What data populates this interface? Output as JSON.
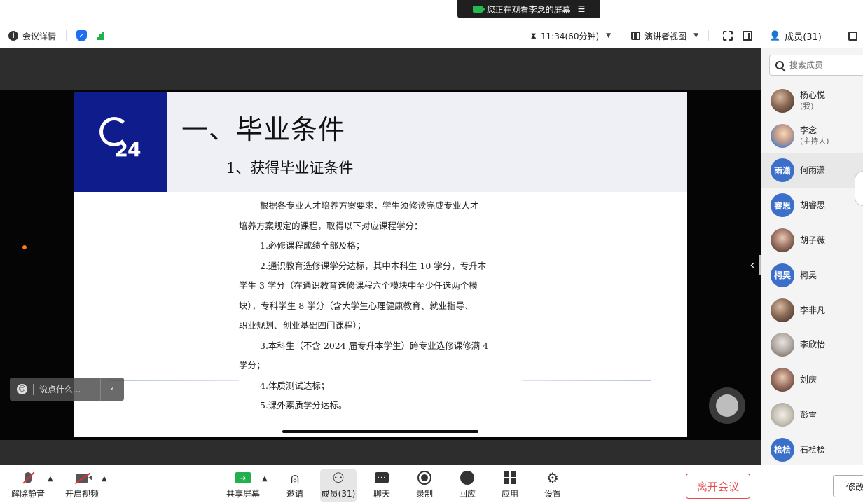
{
  "banner": {
    "text": "您正在观看李念的屏幕",
    "menu_icon": "three-lines-menu"
  },
  "meeting_bar": {
    "info_label": "会议详情",
    "timer": "11:34(60分钟)",
    "view_label": "演讲者视图"
  },
  "members_header": {
    "title": "成员(31)"
  },
  "slide": {
    "title": "一、毕业条件",
    "subtitle": "1、获得毕业证条件",
    "logo_text": "24",
    "lines": [
      "根据各专业人才培养方案要求，学生须修读完成专业人才",
      "培养方案规定的课程，取得以下对应课程学分：",
      "1.必修课程成绩全部及格；",
      "2.通识教育选修课学分达标，其中本科生 10 学分，专升本",
      "学生 3 学分（在通识教育选修课程六个模块中至少任选两个模",
      "块），专科学生 8 学分（含大学生心理健康教育、就业指导、",
      "职业规划、创业基础四门课程）；",
      "3.本科生（不含 2024 届专升本学生）跨专业选修课修满 4",
      "学分；",
      "4.体质测试达标；",
      "5.课外素质学分达标。"
    ]
  },
  "chat": {
    "placeholder": "说点什么..."
  },
  "search": {
    "placeholder": "搜索成员"
  },
  "members": [
    {
      "name": "杨心悦",
      "role": "(我)",
      "avatar": "photo"
    },
    {
      "name": "李念",
      "role": "(主持人)",
      "avatar": "photo"
    },
    {
      "name": "何雨潇",
      "role": "",
      "avatar_text": "雨潇"
    },
    {
      "name": "胡睿思",
      "role": "",
      "avatar_text": "睿思"
    },
    {
      "name": "胡子薇",
      "role": "",
      "avatar": "photo"
    },
    {
      "name": "柯昊",
      "role": "",
      "avatar_text": "柯昊"
    },
    {
      "name": "李非凡",
      "role": "",
      "avatar": "photo"
    },
    {
      "name": "李欣怡",
      "role": "",
      "avatar": "photo"
    },
    {
      "name": "刘庆",
      "role": "",
      "avatar": "photo"
    },
    {
      "name": "彭雪",
      "role": "",
      "avatar": "photo"
    },
    {
      "name": "石桧桧",
      "role": "",
      "avatar_text": "桧桧"
    }
  ],
  "toolbar": {
    "unmute": "解除静音",
    "start_video": "开启视频",
    "share_screen": "共享屏幕",
    "invite": "邀请",
    "members": "成员(31)",
    "chat": "聊天",
    "record": "录制",
    "react": "回应",
    "apps": "应用",
    "settings": "设置",
    "leave": "离开会议",
    "rename": "修改"
  },
  "colors": {
    "accent": "#1d6ff2",
    "leave": "#e84d4d",
    "share": "#22b04c",
    "slide_header": "#0f1d8c"
  }
}
